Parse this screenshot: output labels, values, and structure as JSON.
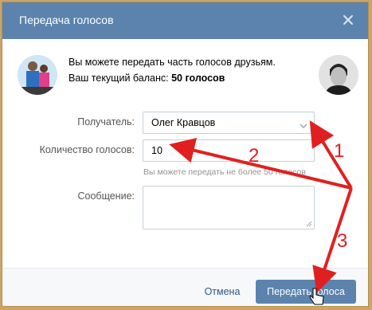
{
  "dialog": {
    "title": "Передача голосов",
    "info_line1": "Вы можете передать часть голосов друзьям.",
    "info_line2_prefix": "Ваш текущий баланс: ",
    "info_line2_balance": "50 голосов"
  },
  "form": {
    "recipient_label": "Получатель:",
    "recipient_value": "Олег Кравцов",
    "quantity_label": "Количество голосов:",
    "quantity_value": "10",
    "quantity_hint": "Вы можете передать не более 50 голосов",
    "message_label": "Сообщение:",
    "message_value": ""
  },
  "footer": {
    "cancel_label": "Отмена",
    "submit_label": "Передать голоса"
  },
  "annotations": {
    "step1": "1",
    "step2": "2",
    "step3": "3"
  },
  "colors": {
    "header": "#5b83ad",
    "button": "#5b83ad",
    "annotation": "#e02020",
    "link": "#2a5885"
  },
  "icons": {
    "close": "close-icon",
    "dropdown": "chevron-down-icon",
    "cursor": "hand-pointer-icon"
  }
}
